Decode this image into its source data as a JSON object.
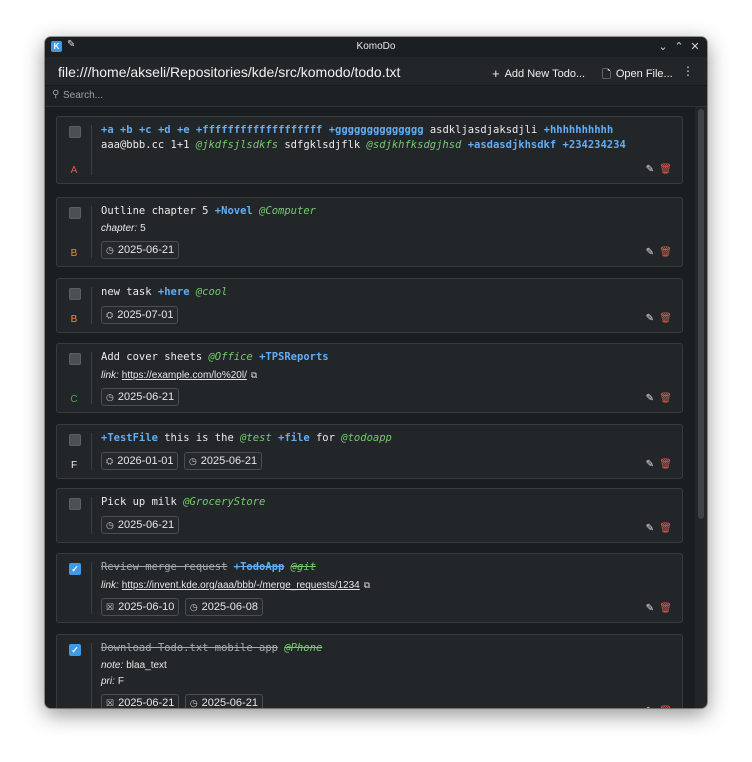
{
  "window": {
    "title": "KomoDo",
    "min": "⌄",
    "max": "⌃",
    "close": "✕"
  },
  "header": {
    "path": "file:///home/akseli/Repositories/kde/src/komodo/todo.txt",
    "add_label": "Add New Todo...",
    "open_label": "Open File...",
    "more": "⋮"
  },
  "search": {
    "placeholder": "Search..."
  },
  "icons": {
    "clock": "◷",
    "threshold": "⛭",
    "calendar": "☒",
    "edit": "✎",
    "delete": "🗑",
    "link_out": "⧉",
    "check": "✓"
  },
  "todos": [
    {
      "priority": "A",
      "done": false
    },
    {
      "priority": "B",
      "done": false,
      "text": "Outline chapter 5",
      "project": "+Novel",
      "context": "@Computer",
      "kv_key": "chapter:",
      "kv_val": "5",
      "date": "2025-06-21"
    },
    {
      "priority": "B",
      "done": false,
      "text": "new task",
      "project": "+here",
      "context": "@cool",
      "threshold": "2025-07-01"
    },
    {
      "priority": "C",
      "done": false,
      "text": "Add cover sheets",
      "context": "@Office",
      "project": "+TPSReports",
      "link_key": "link:",
      "link": "https://example.com/lo%20l/",
      "date": "2025-06-21"
    },
    {
      "priority": "F",
      "done": false,
      "project": "+TestFile",
      "text": "this is the",
      "context": "@test",
      "project2": "+file",
      "text2": "for",
      "context2": "@todoapp",
      "threshold": "2026-01-01",
      "date": "2025-06-21"
    },
    {
      "priority": "",
      "done": true,
      "text": "Pick up milk",
      "context": "@GroceryStore",
      "date": "2025-06-21"
    },
    {
      "priority": "",
      "done": true,
      "text": "Review merge request",
      "project": "+TodoApp",
      "context": "@git",
      "link_key": "link:",
      "link": "https://invent.kde.org/aaa/bbb/-/merge_requests/1234",
      "completion": "2025-06-10",
      "date": "2025-06-08"
    },
    {
      "priority": "",
      "done": true,
      "text": "Download Todo.txt mobile app",
      "context": "@Phone",
      "note_key": "note:",
      "note_val": "blaa_text",
      "pri_key": "pri:",
      "pri_val": "F",
      "completion": "2025-06-21",
      "date": "2025-06-21"
    }
  ],
  "todo0": {
    "p1": "+a",
    "p2": "+b",
    "p3": "+c",
    "p4": "+d",
    "p5": "+e",
    "p6": "+fffffffffffffffffff",
    "p7": "+gggggggggggggg",
    "t1": "asdkljasdjaksdjli",
    "p8": "+hhhhhhhhhh",
    "t2": "aaa@bbb.cc 1+1",
    "c1": "@jkdfsjlsdkfs",
    "t3": "sdfgklsdjflk",
    "c2": "@sdjkhfksdgjhsd",
    "p9": "+asdasdjkhsdkf",
    "p10": "+234234234"
  }
}
